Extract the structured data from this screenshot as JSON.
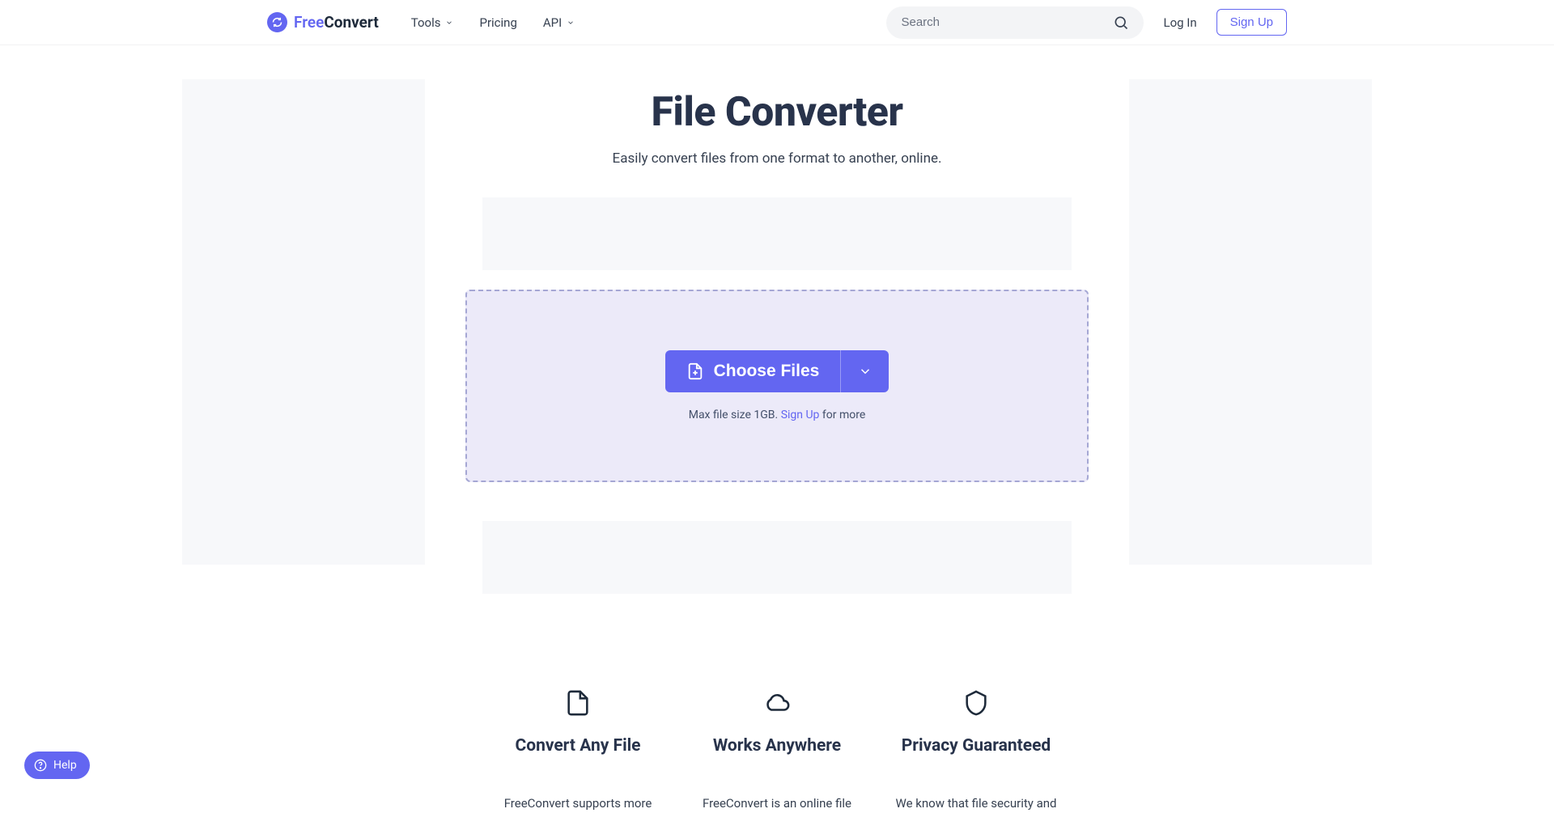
{
  "header": {
    "logo": {
      "free": "Free",
      "convert": "Convert"
    },
    "nav": {
      "tools": "Tools",
      "pricing": "Pricing",
      "api": "API"
    },
    "search_placeholder": "Search",
    "login": "Log In",
    "signup": "Sign Up"
  },
  "hero": {
    "title": "File Converter",
    "subtitle": "Easily convert files from one format to another, online."
  },
  "dropzone": {
    "choose_label": "Choose Files",
    "size_note_prefix": "Max file size 1GB. ",
    "size_note_link": "Sign Up",
    "size_note_suffix": " for more"
  },
  "features": [
    {
      "title": "Convert Any File",
      "body": "FreeConvert supports more"
    },
    {
      "title": "Works Anywhere",
      "body": "FreeConvert is an online file"
    },
    {
      "title": "Privacy Guaranteed",
      "body": "We know that file security and"
    }
  ],
  "help": {
    "label": "Help"
  }
}
